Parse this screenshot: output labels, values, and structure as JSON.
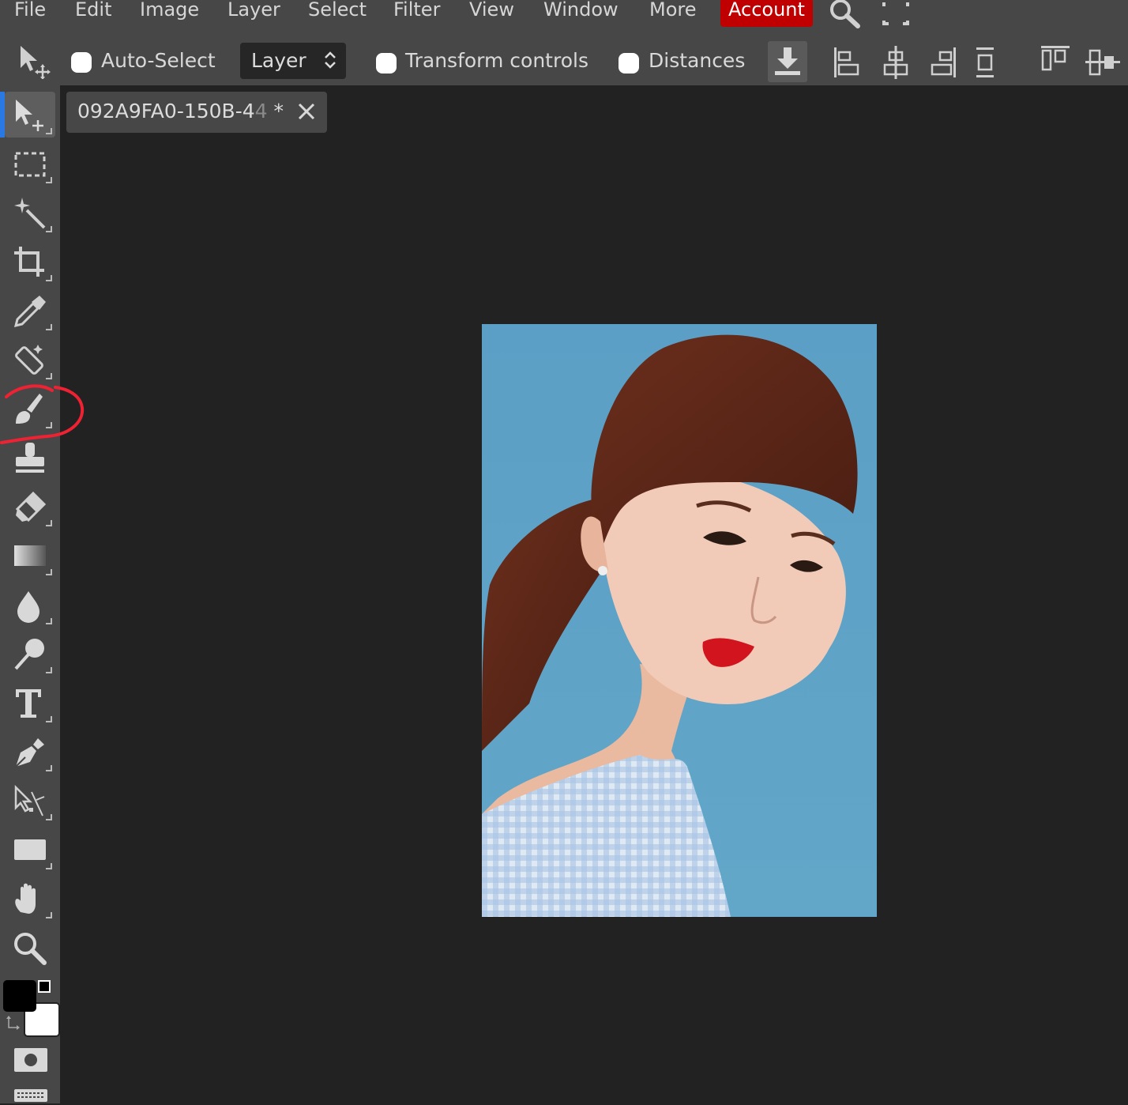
{
  "menu": {
    "items": [
      "File",
      "Edit",
      "Image",
      "Layer",
      "Select",
      "Filter",
      "View",
      "Window",
      "More"
    ],
    "account_label": "Account",
    "account_color": "#c00000"
  },
  "options": {
    "auto_select_label": "Auto-Select",
    "auto_select_checked": false,
    "layer_select_value": "Layer",
    "transform_controls_label": "Transform controls",
    "transform_controls_checked": false,
    "distances_label": "Distances",
    "distances_checked": false
  },
  "document": {
    "tab_name": "092A9FA0-150B-4",
    "tab_name_faded": "4",
    "tab_modified": "*"
  },
  "toolbar": {
    "active_tool": "move-tool",
    "highlight_color": "#2a78e4",
    "tools": [
      "move-tool",
      "marquee-tool",
      "magic-wand-tool",
      "crop-tool",
      "eyedropper-tool",
      "healing-tool",
      "brush-tool",
      "clone-stamp-tool",
      "eraser-tool",
      "gradient-tool",
      "blur-tool",
      "dodge-tool",
      "type-tool",
      "pen-tool",
      "path-select-tool",
      "rectangle-tool",
      "hand-tool",
      "zoom-tool"
    ],
    "foreground_color": "#000000",
    "background_color": "#ffffff",
    "annotation_color": "#ee2233"
  },
  "icons": {
    "search": "search-icon",
    "fullscreen": "fullscreen-icon",
    "download": "download-icon",
    "close": "close-icon"
  }
}
